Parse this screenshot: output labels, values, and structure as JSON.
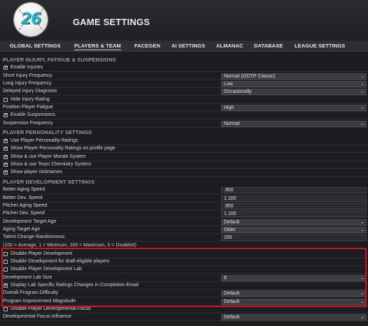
{
  "header": {
    "logo_text": "26",
    "title": "GAME SETTINGS"
  },
  "tabs": [
    {
      "label": "GLOBAL SETTINGS"
    },
    {
      "label": "PLAYERS & TEAM"
    },
    {
      "label": "FACEGEN"
    },
    {
      "label": "AI SETTINGS"
    },
    {
      "label": "ALMANAC"
    },
    {
      "label": "DATABASE"
    },
    {
      "label": "LEAGUE SETTINGS"
    }
  ],
  "sections": {
    "injury": "PLAYER INJURY, FATIGUE & SUSPENSIONS",
    "personality": "PLAYER PERSONALITY SETTINGS",
    "development": "PLAYER DEVELOPMENT SETTINGS"
  },
  "injury_rows": {
    "enable_injuries": "Enable Injuries",
    "short_injury_label": "Short Injury Frequency",
    "short_injury_value": "Normal (OOTP Classic)",
    "long_injury_label": "Long Injury Frequency",
    "long_injury_value": "Low",
    "delayed_label": "Delayed Injury Diagnosis",
    "delayed_value": "Occasionally",
    "hide_injury": "Hide Injury Rating",
    "fatigue_label": "Position Player Fatigue",
    "fatigue_value": "High",
    "enable_suspensions": "Enable Suspensions",
    "suspension_label": "Suspension Frequency",
    "suspension_value": "Normal"
  },
  "personality_rows": {
    "use_ratings": "Use Player Personality Ratings",
    "show_ratings": "Show Player Personality Ratings on profile page",
    "morale": "Show & use Player Morale System",
    "chemistry": "Show & use Team Chemistry System",
    "nicknames": "Show player nicknames"
  },
  "development_rows": {
    "batter_aging_label": "Batter Aging Speed",
    "batter_aging_value": ".950",
    "batter_dev_label": "Batter Dev. Speed",
    "batter_dev_value": "1.100",
    "pitcher_aging_label": "Pitcher Aging Speed",
    "pitcher_aging_value": ".950",
    "pitcher_dev_label": "Pitcher Dev. Speed",
    "pitcher_dev_value": "1.100",
    "dev_target_label": "Development Target Age",
    "dev_target_value": "Default",
    "aging_target_label": "Aging Target Age",
    "aging_target_value": "Older",
    "talent_label": "Talent Change Randomness",
    "talent_value": "100",
    "talent_note": "(100 = Average, 1 = Minimum, 200 = Maximum, 0 = Disabled)",
    "disable_dev": "Disable Player Development",
    "disable_draft": "Disable Development for draft-eligible players",
    "disable_lab": "Disable Player Development Lab",
    "lab_size_label": "Development Lab Size",
    "lab_size_value": "8",
    "display_lab": "Display Lab Specific Ratings Changes in Completion Email",
    "overall_label": "Overall Program Difficulty",
    "overall_value": "Default",
    "improvement_label": "Program Improvement Magnitude",
    "improvement_value": "Default",
    "disable_focus": "Disable Player Developmental Focus",
    "focus_label": "Developmental Focus Influence",
    "focus_value": "Default"
  },
  "icons": {
    "check": "✔",
    "dropdown": "chevron-down-icon"
  },
  "colors": {
    "highlight": "#d0101b",
    "accent": "#2fb6c8"
  }
}
